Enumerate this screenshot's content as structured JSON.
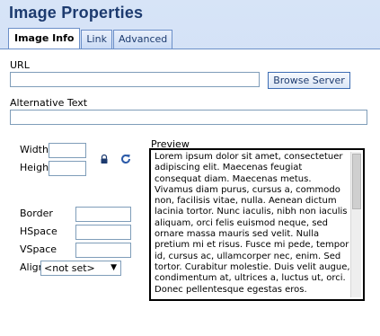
{
  "dialog": {
    "title": "Image Properties"
  },
  "tabs": [
    {
      "label": "Image Info",
      "active": true
    },
    {
      "label": "Link",
      "active": false
    },
    {
      "label": "Advanced",
      "active": false
    }
  ],
  "form": {
    "url_label": "URL",
    "url_value": "",
    "browse_server_label": "Browse Server",
    "alt_text_label": "Alternative Text",
    "alt_text_value": "",
    "width_label": "Width",
    "width_value": "",
    "height_label": "Height",
    "height_value": "",
    "border_label": "Border",
    "border_value": "",
    "hspace_label": "HSpace",
    "hspace_value": "",
    "vspace_label": "VSpace",
    "vspace_value": "",
    "align_label": "Align",
    "align_value": "<not set>",
    "preview_label": "Preview",
    "preview_text": "Lorem ipsum dolor sit amet, consectetuer adipiscing elit. Maecenas feugiat consequat diam. Maecenas metus. Vivamus diam purus, cursus a, commodo non, facilisis vitae, nulla. Aenean dictum lacinia tortor. Nunc iaculis, nibh non iaculis aliquam, orci felis euismod neque, sed ornare massa mauris sed velit. Nulla pretium mi et risus. Fusce mi pede, tempor id, cursus ac, ullamcorper nec, enim. Sed tortor. Curabitur molestie. Duis velit augue, condimentum at, ultrices a, luctus ut, orci. Donec pellentesque egestas eros."
  },
  "icons": {
    "lock_ratio": "lock-icon",
    "reset_size": "reset-size-icon"
  },
  "colors": {
    "title": "#1d3b6f",
    "header_bg": "#c6d8f4",
    "tab_border": "#6b8fc8",
    "button_text": "#1d3b6f"
  }
}
